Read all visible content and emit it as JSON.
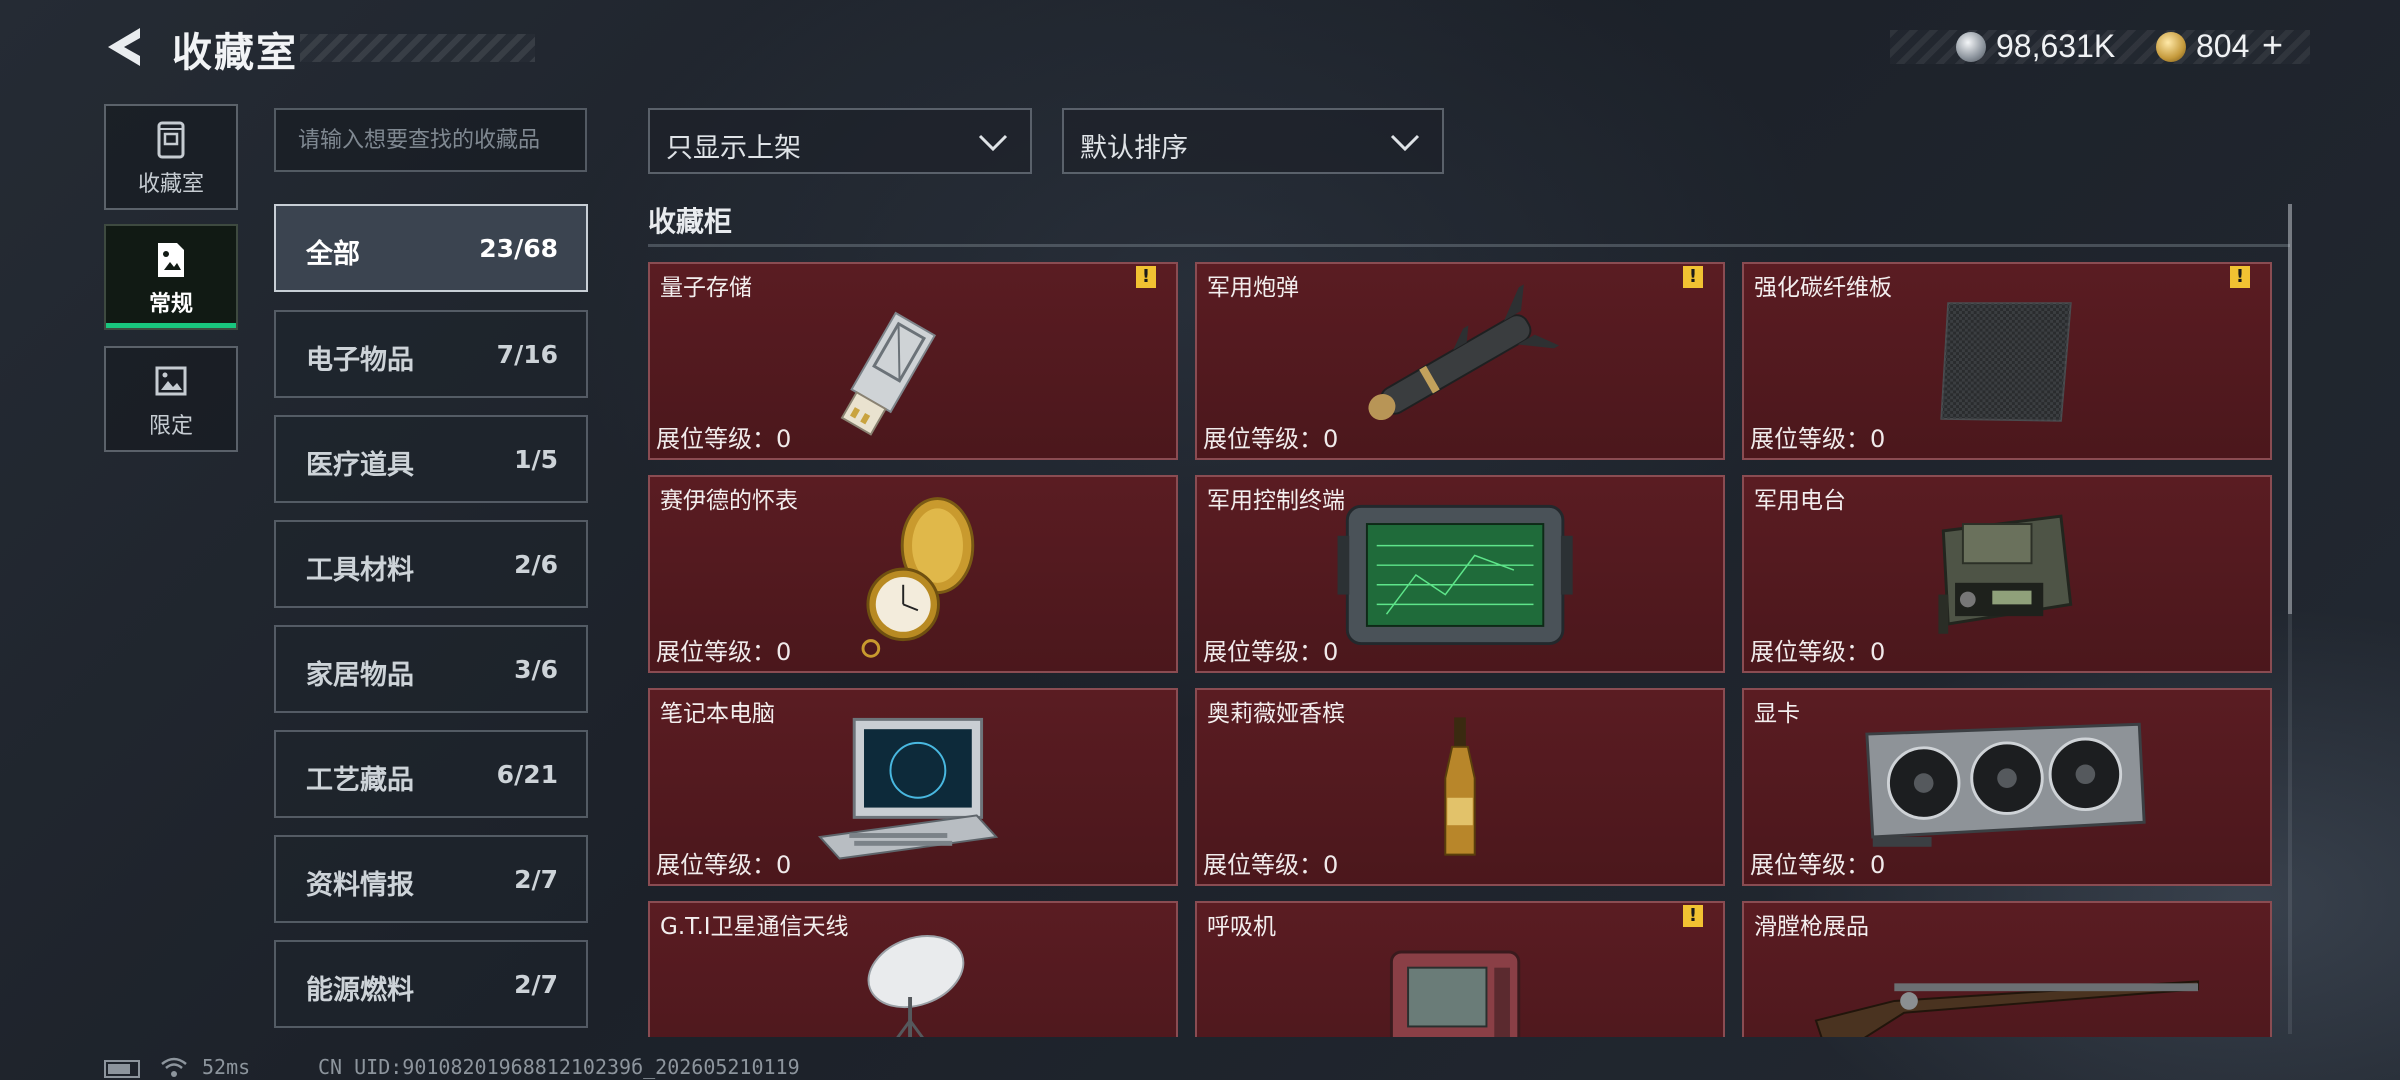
{
  "header": {
    "title": "收藏室"
  },
  "currency": {
    "silver": "98,631K",
    "gold": "804",
    "add": "+"
  },
  "side_tabs": [
    {
      "label": "收藏室",
      "icon": "cabinet-icon"
    },
    {
      "label": "常规",
      "icon": "document-icon",
      "active": true
    },
    {
      "label": "限定",
      "icon": "image-icon"
    }
  ],
  "search": {
    "placeholder": "请输入想要查找的收藏品"
  },
  "filters": {
    "shelf": "只显示上架",
    "sort": "默认排序"
  },
  "categories": [
    {
      "name": "全部",
      "count": "23/68",
      "active": true
    },
    {
      "name": "电子物品",
      "count": "7/16"
    },
    {
      "name": "医疗道具",
      "count": "1/5"
    },
    {
      "name": "工具材料",
      "count": "2/6"
    },
    {
      "name": "家居物品",
      "count": "3/6"
    },
    {
      "name": "工艺藏品",
      "count": "6/21"
    },
    {
      "name": "资料情报",
      "count": "2/7"
    },
    {
      "name": "能源燃料",
      "count": "2/7"
    }
  ],
  "section": {
    "title": "收藏柜"
  },
  "level_label": "展位等级：0",
  "items": [
    {
      "name": "量子存储",
      "warn": true,
      "icon": "usb-drive-icon"
    },
    {
      "name": "军用炮弹",
      "warn": true,
      "icon": "missile-icon"
    },
    {
      "name": "强化碳纤维板",
      "warn": true,
      "icon": "carbon-plate-icon"
    },
    {
      "name": "赛伊德的怀表",
      "warn": false,
      "icon": "pocket-watch-icon"
    },
    {
      "name": "军用控制终端",
      "warn": false,
      "icon": "terminal-icon"
    },
    {
      "name": "军用电台",
      "warn": false,
      "icon": "radio-icon"
    },
    {
      "name": "笔记本电脑",
      "warn": false,
      "icon": "laptop-icon"
    },
    {
      "name": "奥莉薇娅香槟",
      "warn": false,
      "icon": "champagne-icon"
    },
    {
      "name": "显卡",
      "warn": false,
      "icon": "graphics-card-icon"
    },
    {
      "name": "G.T.I卫星通信天线",
      "warn": false,
      "icon": "satellite-dish-icon"
    },
    {
      "name": "呼吸机",
      "warn": true,
      "icon": "ventilator-icon"
    },
    {
      "name": "滑膛枪展品",
      "warn": false,
      "icon": "musket-icon"
    }
  ],
  "warn_symbol": "!",
  "status": {
    "ping": "52ms",
    "uid": "CN UID:9010820196881210239б_202605210119"
  }
}
